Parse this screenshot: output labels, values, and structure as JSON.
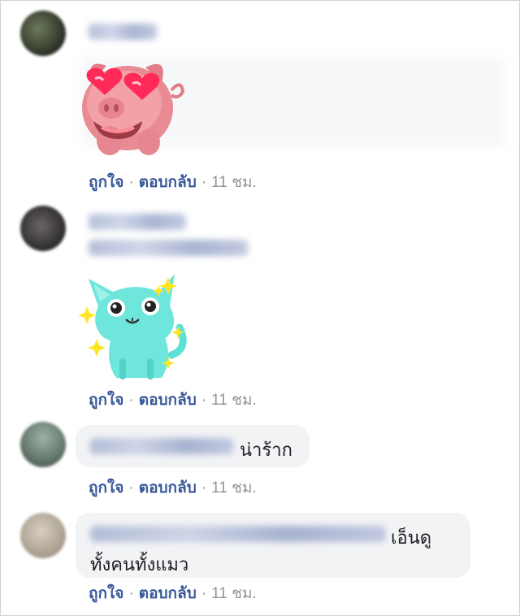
{
  "comments": [
    {
      "type": "sticker",
      "sticker": "pig-heart-eyes-sticker",
      "actions": {
        "like": "ถูกใจ",
        "reply": "ตอบกลับ",
        "time": "11 ชม."
      }
    },
    {
      "type": "sticker",
      "sticker": "cat-sparkle-sticker",
      "actions": {
        "like": "ถูกใจ",
        "reply": "ตอบกลับ",
        "time": "11 ชม."
      }
    },
    {
      "type": "text",
      "text": "น่าร้าก",
      "actions": {
        "like": "ถูกใจ",
        "reply": "ตอบกลับ",
        "time": "11 ชม."
      }
    },
    {
      "type": "text",
      "text_line1": "เอ็นดู",
      "text_line2": "ทั้งคนทั้งแมว",
      "actions": {
        "like": "ถูกใจ",
        "reply": "ตอบกลับ",
        "time": "11 ชม."
      }
    }
  ],
  "separator": "·",
  "colors": {
    "link": "#385898",
    "meta": "#90949c",
    "bubble": "#f2f3f5",
    "text": "#1c1e21"
  }
}
